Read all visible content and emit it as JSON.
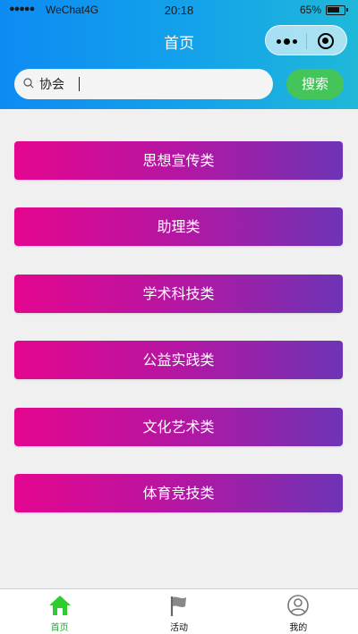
{
  "status_bar": {
    "signal": "●●●●●",
    "carrier": "WeChat4G",
    "time": "20:18",
    "battery": "65%"
  },
  "nav": {
    "title": "首页",
    "more_icon": "more-dots-icon",
    "close_icon": "target-close-icon"
  },
  "search": {
    "value": "协会",
    "placeholder": "",
    "button_label": "搜索",
    "icon": "search-icon"
  },
  "categories": [
    {
      "label": "思想宣传类"
    },
    {
      "label": "助理类"
    },
    {
      "label": "学术科技类"
    },
    {
      "label": "公益实践类"
    },
    {
      "label": "文化艺术类"
    },
    {
      "label": "体育竞技类"
    }
  ],
  "tabbar": {
    "tabs": [
      {
        "label": "首页",
        "icon": "home-icon",
        "active": true
      },
      {
        "label": "活动",
        "icon": "flag-icon",
        "active": false
      },
      {
        "label": "我的",
        "icon": "user-icon",
        "active": false
      }
    ]
  },
  "colors": {
    "header_start": "#0d8bf3",
    "header_end": "#1fb8d8",
    "category_start": "#e5068f",
    "category_end": "#6e34b6",
    "search_button": "#45c45a",
    "tab_active": "#1fae2e"
  }
}
